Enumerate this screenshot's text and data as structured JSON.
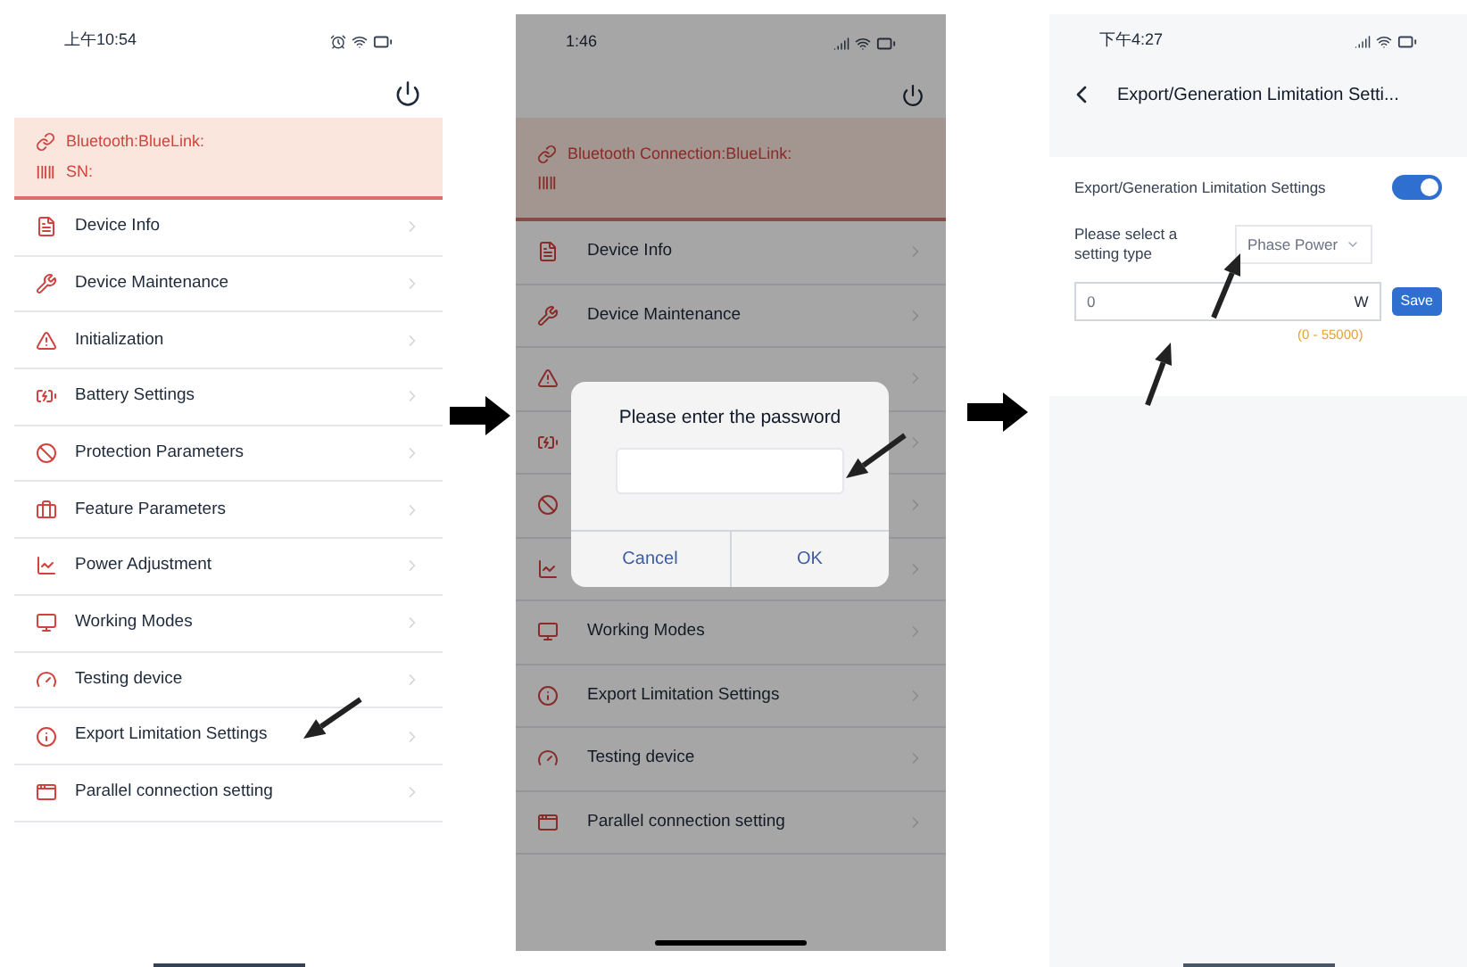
{
  "left_screen": {
    "status_time": "上午10:54",
    "banner": [
      {
        "kind": "link",
        "text": "Bluetooth:BlueLink:"
      },
      {
        "kind": "barcode",
        "text": "SN:"
      }
    ],
    "items": [
      {
        "kind": "info",
        "label": "Device Info"
      },
      {
        "kind": "maintenance",
        "label": "Device Maintenance"
      },
      {
        "kind": "init",
        "label": "Initialization"
      },
      {
        "kind": "battery",
        "label": "Battery Settings"
      },
      {
        "kind": "protection",
        "label": "Protection Parameters"
      },
      {
        "kind": "feature",
        "label": "Feature Parameters"
      },
      {
        "kind": "power",
        "label": "Power Adjustment"
      },
      {
        "kind": "modes",
        "label": "Working Modes"
      },
      {
        "kind": "testing",
        "label": "Testing device"
      },
      {
        "kind": "export",
        "label": "Export Limitation Settings"
      },
      {
        "kind": "parallel",
        "label": "Parallel connection setting"
      }
    ]
  },
  "middle_screen": {
    "status_time": "1:46",
    "banner": [
      {
        "kind": "link",
        "text": "Bluetooth Connection:BlueLink:"
      },
      {
        "kind": "barcode"
      }
    ],
    "items": [
      {
        "kind": "info",
        "label": "Device Info"
      },
      {
        "kind": "maintenance",
        "label": "Device Maintenance"
      },
      {
        "kind": "init"
      },
      {
        "kind": "battery"
      },
      {
        "kind": "protection"
      },
      {
        "kind": "power"
      },
      {
        "kind": "modes",
        "label": "Working Modes"
      },
      {
        "kind": "export",
        "label": "Export Limitation Settings"
      },
      {
        "kind": "testing",
        "label": "Testing device"
      },
      {
        "kind": "parallel",
        "label": "Parallel connection setting"
      }
    ],
    "dialog": {
      "title": "Please enter the password",
      "buttons": [
        "Cancel",
        "OK"
      ]
    }
  },
  "right_screen": {
    "status_time": "下午4:27",
    "title": "Export/Generation Limitation Setti...",
    "toggle": {
      "label": "Export/Generation Limitation Settings",
      "on": true
    },
    "setting_type": {
      "label": "Please select a setting type",
      "value": "Phase Power"
    },
    "power_field": {
      "value": "0",
      "unit": "W",
      "range": "(0 - 55000)"
    },
    "save_button": "Save"
  }
}
